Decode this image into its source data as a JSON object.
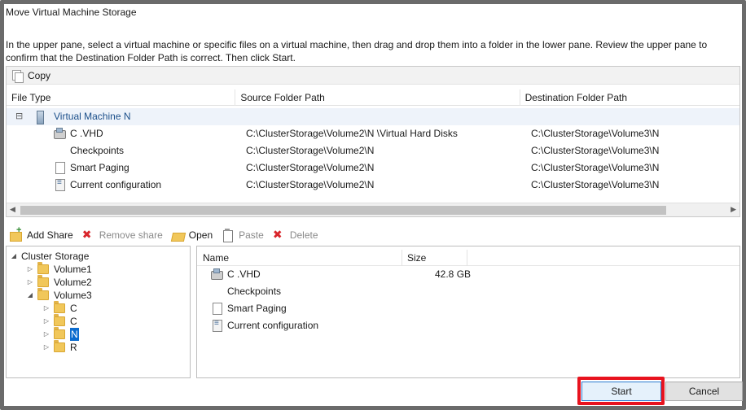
{
  "window": {
    "title": "Move Virtual Machine Storage"
  },
  "instructions": "In the upper pane, select a virtual machine or specific files on a virtual machine, then drag and drop them into a folder in the lower pane.  Review the upper pane to confirm that the Destination Folder Path is correct. Then click Start.",
  "upper_toolbar": {
    "copy_label": "Copy"
  },
  "upper_grid": {
    "columns": [
      "File Type",
      "Source Folder Path",
      "Destination Folder Path"
    ],
    "vm_row": {
      "expander": "⊟",
      "name": "Virtual Machine N"
    },
    "rows": [
      {
        "icon": "disk-icon",
        "type": "C                 .VHD",
        "source": "C:\\ClusterStorage\\Volume2\\N                 \\Virtual Hard Disks",
        "dest": "C:\\ClusterStorage\\Volume3\\N"
      },
      {
        "icon": "",
        "type": "Checkpoints",
        "source": "C:\\ClusterStorage\\Volume2\\N",
        "dest": "C:\\ClusterStorage\\Volume3\\N"
      },
      {
        "icon": "page-icon",
        "type": "Smart Paging",
        "source": "C:\\ClusterStorage\\Volume2\\N",
        "dest": "C:\\ClusterStorage\\Volume3\\N"
      },
      {
        "icon": "config-icon",
        "type": "Current configuration",
        "source": "C:\\ClusterStorage\\Volume2\\N",
        "dest": "C:\\ClusterStorage\\Volume3\\N"
      }
    ]
  },
  "lower_toolbar": {
    "add_share": "Add Share",
    "remove_share": "Remove share",
    "open": "Open",
    "paste": "Paste",
    "delete": "Delete"
  },
  "tree": {
    "root": "Cluster Storage",
    "items": [
      {
        "label": "Volume1",
        "level": 1
      },
      {
        "label": "Volume2",
        "level": 1
      },
      {
        "label": "Volume3",
        "level": 1
      },
      {
        "label": "C",
        "level": 2
      },
      {
        "label": "C",
        "level": 2
      },
      {
        "label": "N",
        "level": 2,
        "selected": true
      },
      {
        "label": "R",
        "level": 2
      }
    ]
  },
  "file_list": {
    "columns": [
      "Name",
      "Size"
    ],
    "rows": [
      {
        "icon": "disk-icon",
        "name": "C                 .VHD",
        "size": "42.8 GB"
      },
      {
        "icon": "",
        "name": "Checkpoints",
        "size": ""
      },
      {
        "icon": "page-icon",
        "name": "Smart Paging",
        "size": ""
      },
      {
        "icon": "config-icon",
        "name": "Current configuration",
        "size": ""
      }
    ]
  },
  "buttons": {
    "start": "Start",
    "cancel": "Cancel"
  },
  "colors": {
    "highlight": "#e8131e",
    "selection": "#0c6ccf",
    "vm_row_text": "#1b4f8a"
  }
}
